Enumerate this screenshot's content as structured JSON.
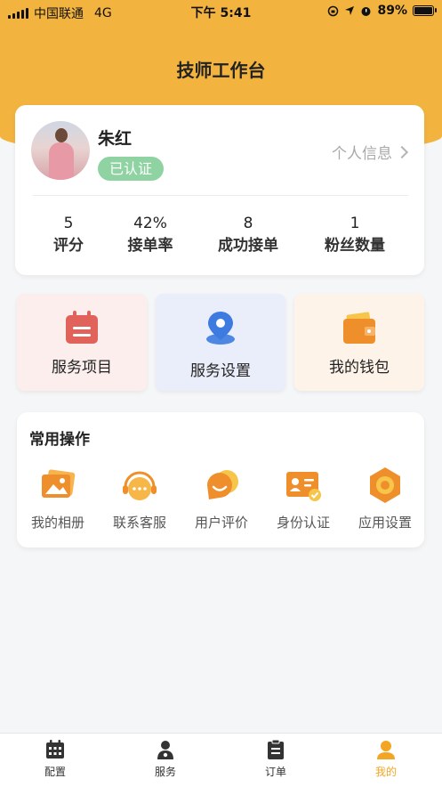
{
  "status_bar": {
    "carrier": "中国联通",
    "network": "4G",
    "time": "下午 5:41",
    "battery": "89%",
    "battery_level": 0.89
  },
  "header": {
    "title": "技师工作台"
  },
  "profile": {
    "name": "朱红",
    "badge": "已认证",
    "link_label": "个人信息",
    "stats": [
      {
        "value": "5",
        "label": "评分"
      },
      {
        "value": "42%",
        "label": "接单率"
      },
      {
        "value": "8",
        "label": "成功接单"
      },
      {
        "value": "1",
        "label": "粉丝数量"
      }
    ]
  },
  "tiles": [
    {
      "label": "服务项目",
      "icon": "calendar-icon",
      "bg": "#fbeeed",
      "color": "#e0625b"
    },
    {
      "label": "服务设置",
      "icon": "location-pin-icon",
      "bg": "#eaeefb",
      "color": "#3d7be0"
    },
    {
      "label": "我的钱包",
      "icon": "wallet-icon",
      "bg": "#fdf3e9",
      "color": "#ef8f2b"
    }
  ],
  "common_ops": {
    "title": "常用操作",
    "items": [
      {
        "label": "我的相册",
        "icon": "album-icon"
      },
      {
        "label": "联系客服",
        "icon": "customer-service-icon"
      },
      {
        "label": "用户评价",
        "icon": "review-icon"
      },
      {
        "label": "身份认证",
        "icon": "id-card-icon"
      },
      {
        "label": "应用设置",
        "icon": "settings-hexagon-icon"
      }
    ]
  },
  "tabbar": {
    "items": [
      {
        "label": "配置",
        "icon": "calendar-grid-icon"
      },
      {
        "label": "服务",
        "icon": "person-badge-icon"
      },
      {
        "label": "订单",
        "icon": "clipboard-icon"
      },
      {
        "label": "我的",
        "icon": "user-icon"
      }
    ],
    "active_index": 3,
    "active_color": "#f3a623"
  },
  "colors": {
    "brand": "#f3b33f",
    "verified": "#8fd3a3"
  }
}
